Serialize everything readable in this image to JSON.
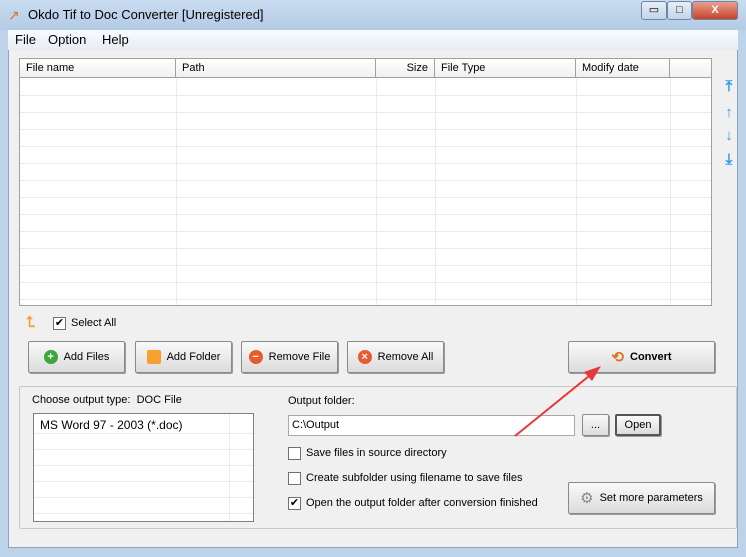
{
  "window": {
    "title": "Okdo Tif to Doc Converter [Unregistered]",
    "minimize": "▭",
    "maximize": "□",
    "close": "X"
  },
  "menu": [
    "File",
    "Option",
    "Help"
  ],
  "table": {
    "columns": [
      "File name",
      "Path",
      "Size",
      "File Type",
      "Modify date",
      ""
    ],
    "rows": []
  },
  "side_arrows": {
    "top": "⤒",
    "up": "↑",
    "down": "↓",
    "bottom": "⤓"
  },
  "select_all": {
    "label": "Select All",
    "checked": true
  },
  "buttons": {
    "add_files": "Add Files",
    "add_folder": "Add Folder",
    "remove_file": "Remove File",
    "remove_all": "Remove All",
    "convert": "Convert",
    "browse": "...",
    "open": "Open",
    "more_params": "Set more parameters"
  },
  "output": {
    "type_label": "Choose output type:",
    "type_value": "DOC File",
    "types": [
      "MS Word 97 - 2003 (*.doc)"
    ],
    "folder_label": "Output folder:",
    "folder_value": "C:\\Output"
  },
  "options": [
    {
      "label": "Save files in source directory",
      "checked": false
    },
    {
      "label": "Create subfolder using filename to save files",
      "checked": false
    },
    {
      "label": "Open the output folder after conversion finished",
      "checked": true
    }
  ],
  "colors": {
    "annotation_arrow": "#e8393a",
    "accent": "#2b9be0"
  }
}
